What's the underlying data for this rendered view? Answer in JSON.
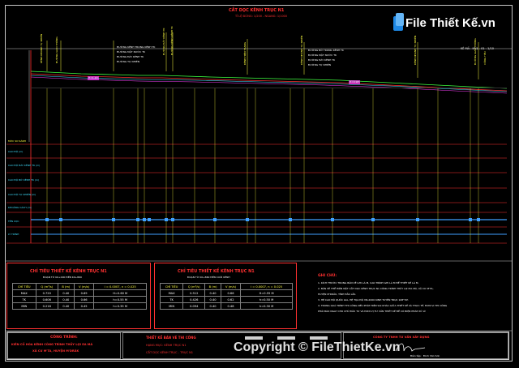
{
  "drawing": {
    "title": "CẮT DỌC KÊNH TRỤC N1",
    "scale": "TỈ LỆ ĐỨNG: 1/200 - NGANG: 1/1000",
    "sheet_no": "KÊ MÃ - KN1 - 01 - 1/10"
  },
  "site_labels": [
    {
      "text": "KÊNH NHÁNH TỰ NHIÊN"
    },
    {
      "text": "ĐƯỜNG GIAO THÔNG"
    },
    {
      "text": "ĐƯỜNG ĐẤT KÊNH TK"
    },
    {
      "text": "ĐƯỜNG KÊNH KÊNH TK"
    },
    {
      "text": "KÊNH HIỆN TRẠNG"
    },
    {
      "text": "KÊNH NHÁNH TỰ NHIÊN"
    },
    {
      "text": "KÊNH NHÁNH TỰ NHIÊN"
    },
    {
      "text": "ĐƯỜNG GIAO THÔNG"
    },
    {
      "text": "CỐNG TIÊU"
    }
  ],
  "profile_callouts_left": [
    "ĐƯỜNG KÊNH TRONG KÊNH TK",
    "ĐƯỜNG MẶT NƯỚC TK",
    "ĐƯỜNG ĐÁY KÊNH TK",
    "ĐƯỜNG TỰ NHIÊN"
  ],
  "profile_callouts_right": [
    "ĐƯỜNG BỜ TRONG KÊNH TK",
    "ĐƯỜNG MẶT NƯỚC TK",
    "ĐƯỜNG ĐÁY KÊNH TK",
    "ĐƯỜNG TỰ NHIÊN"
  ],
  "profile_tag_left": "H=1.2m",
  "profile_tag_mid": "H=1.2m",
  "profile_tag_right": "H=0.9m",
  "row_labels": [
    "CAO ĐỘ (m)",
    "CAO ĐỘ ĐÁY KÊNH TK (m)",
    "CAO ĐỘ BỜ KÊNH TK (m)",
    "CAO ĐỘ TỰ NHIÊN (m)",
    "KHOẢNG CÁCH (m)",
    "TÊN CỌC",
    "LÝ TRÌNH"
  ],
  "datum_label": "MỨC SO SÁNH",
  "table_left": {
    "title": "CHỈ TIÊU THIẾT KẾ KÊNH TRỤC N1",
    "subtitle": "ĐOẠN TỪ K0+000 ĐẾN K0+860",
    "headers": [
      "CHỈ TIÊU",
      "Q (m³/s)",
      "B (m)",
      "V (m/s)",
      "i = 0.0007, n = 0.025"
    ],
    "rows": [
      [
        "MAX",
        "0.720",
        "0.40",
        "0.69",
        "H=0.60 M"
      ],
      [
        "TK",
        "0.606",
        "0.40",
        "0.66",
        "h=0.55 M"
      ],
      [
        "MIN",
        "0.216",
        "0.40",
        "0.45",
        "h=0.35 M"
      ]
    ]
  },
  "table_right": {
    "title": "CHỈ TIÊU THIẾT KẾ KÊNH TRỤC N1",
    "subtitle": "ĐOẠN TỪ K0+860 ĐẾN CUỐI KÊNH",
    "headers": [
      "CHỈ TIÊU",
      "Q (m³/s)",
      "B (m)",
      "V (m/s)",
      "i = 0.0007, n = 0.025"
    ],
    "rows": [
      [
        "MAX",
        "0.512",
        "0.40",
        "0.66",
        "H=0.55 M"
      ],
      [
        "TK",
        "0.426",
        "0.40",
        "0.62",
        "h=0.50 M"
      ],
      [
        "MIN",
        "0.094",
        "0.40",
        "0.48",
        "h=0.30 M"
      ]
    ]
  },
  "notes": {
    "title": "GHI CHÚ:",
    "lines": [
      "1. KÍCH THƯỚC TRONG BẢN VẼ GHI LÀ M, CAO TRÌNH GHI LÀ M ĐỂ THIẾT KẾ LÀ M.",
      "2. BẢN VẼ THỂ HIỆN MẶT CẮT DỌC KÊNH TRỤC N1 CÔNG TRÌNH THỦY LỢI EA MÁ, XÃ CƯ M'TA,",
      "HUYỆN M'DRĂK, TỈNH ĐẮK LẮK.",
      "3. HỆ CAO ĐỘ QUỐC GIA, HỆ TỌA ĐỘ VN-2000 KINH TUYẾN TRỤC 108°30'.",
      "4. TRONG QUÁ TRÌNH THI CÔNG NẾU PHÁT HIỆN SAI KHÁC GIỮA THIẾT KẾ VÀ THỰC TẾ, ĐƠN VỊ THI CÔNG",
      "PHẢI BÁO NGAY CHO CHỦ ĐẦU TƯ VÀ ĐƠN VỊ TƯ VẤN THIẾT KẾ ĐỂ CÓ BIỆN PHÁP XỬ LÝ."
    ]
  },
  "title_block": {
    "project_label": "CÔNG TRÌNH:",
    "project_line1": "KIÊN CỐ HÓA KÊNH CÔNG TRÌNH THỦY LỢI EA MÁ",
    "project_line2": "XÃ CƯ M'TA, HUYỆN M'DRĂK",
    "stage": "THIẾT KẾ BẢN VẼ THI CÔNG",
    "item_line1": "HẠNG MỤC: KÊNH TRỤC N1",
    "item_line2": "CẮT DỌC KÊNH TRỤC - TRỤC N1",
    "company": "CÔNG TY TNHH TƯ VẤN XÂY DỰNG",
    "signer": "Đinh Văn Sơn",
    "signer_role": "Biên tập:"
  },
  "brand": {
    "logo_text": "File Thiết Kế.vn",
    "watermark": "Copyright © FileThietKe.vn"
  }
}
